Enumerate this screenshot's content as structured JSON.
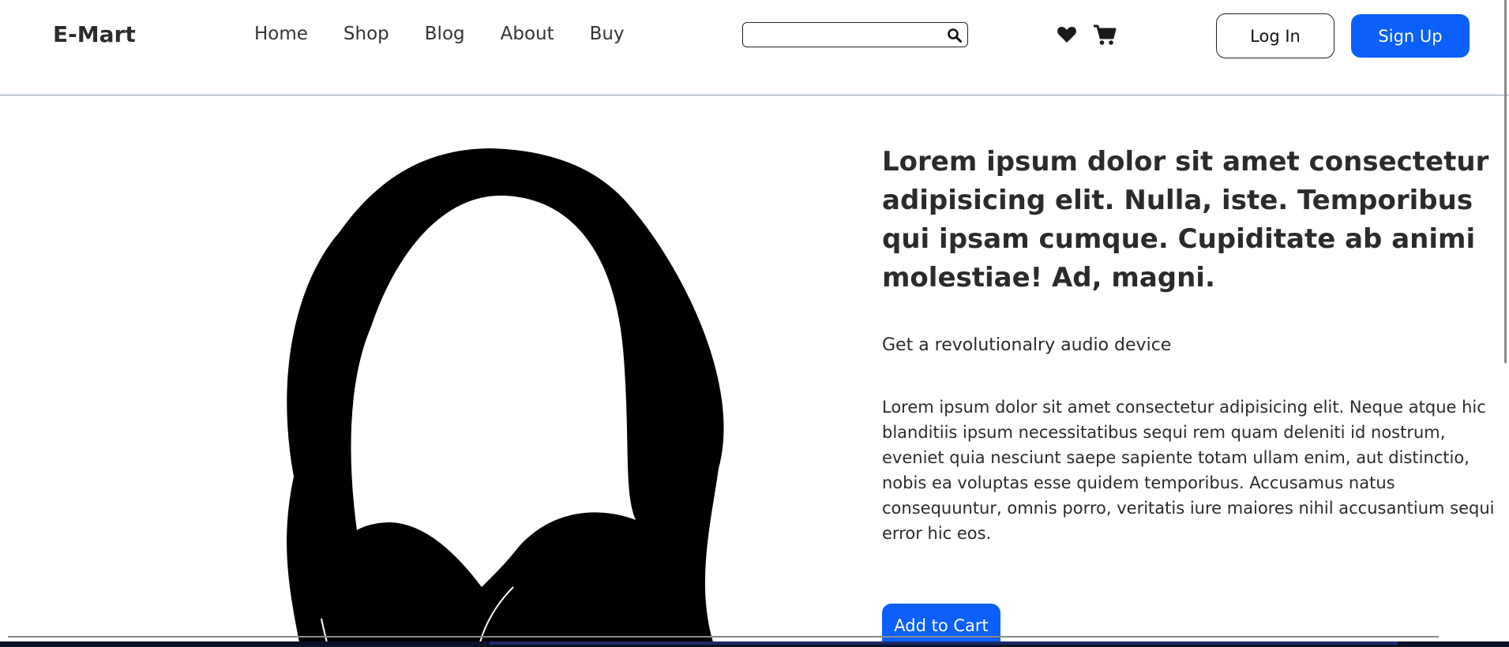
{
  "header": {
    "brand": "E-Mart",
    "nav": [
      "Home",
      "Shop",
      "Blog",
      "About",
      "Buy"
    ],
    "search": {
      "value": "",
      "placeholder": ""
    },
    "icons": [
      "search-icon",
      "heart-icon",
      "cart-icon"
    ],
    "login_label": "Log In",
    "signup_label": "Sign Up"
  },
  "hero": {
    "title": "Lorem ipsum dolor sit amet consectetur adipisicing elit. Nulla, iste. Temporibus qui ipsam cumque. Cupiditate ab animi molestiae! Ad, magni.",
    "subtitle": "Get a revolutionalry audio device",
    "description": "Lorem ipsum dolor sit amet consectetur adipisicing elit. Neque atque hic blanditiis ipsum necessitatibus sequi rem quam deleniti id nostrum, eveniet quia nesciunt saepe sapiente totam ullam enim, aut distinctio, nobis ea voluptas esse quidem temporibus. Accusamus natus consequuntur, omnis porro, veritatis iure maiores nihil accusantium sequi error hic eos.",
    "image": "headphones-image",
    "cart_button": "Add to Cart"
  },
  "colors": {
    "accent": "#0b5ffb",
    "text": "#2b2b2b",
    "divider": "#8c9bae",
    "footer": "#0c1226"
  }
}
